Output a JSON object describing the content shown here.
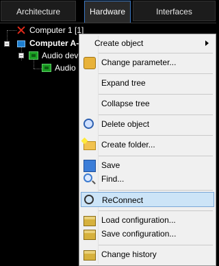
{
  "tabs": [
    {
      "label": "Architecture"
    },
    {
      "label": "Hardware"
    },
    {
      "label": "Interfaces"
    }
  ],
  "tree": {
    "items": [
      {
        "label": "Computer 1 [1]",
        "icon": "error-x-icon"
      },
      {
        "label": "Computer A-",
        "icon": "computer-icon"
      },
      {
        "label": "Audio dev",
        "icon": "audio-device-icon"
      },
      {
        "label": "Audio",
        "icon": "audio-channel-icon"
      }
    ]
  },
  "context_menu": {
    "items": [
      {
        "label": "Create object",
        "icon": "",
        "submenu": true
      },
      {
        "label": "Change parameter...",
        "icon": "key-icon"
      },
      {
        "label": "Expand tree",
        "icon": ""
      },
      {
        "label": "Collapse tree",
        "icon": ""
      },
      {
        "label": "Delete object",
        "icon": "delete-object-icon"
      },
      {
        "label": "Create folder...",
        "icon": "new-folder-icon"
      },
      {
        "label": "Save",
        "icon": "save-icon"
      },
      {
        "label": "Find...",
        "icon": "find-icon"
      },
      {
        "label": "ReConnect",
        "icon": "reconnect-icon",
        "highlighted": true
      },
      {
        "label": "Load configuration...",
        "icon": "box-icon"
      },
      {
        "label": "Save configuration...",
        "icon": "box-icon"
      },
      {
        "label": "Change history",
        "icon": "box-icon"
      }
    ]
  },
  "colors": {
    "background": "#000000",
    "menu_background": "#f0f0f0",
    "highlight": "#cce4f7",
    "active_tab_border": "#3b78c4"
  }
}
